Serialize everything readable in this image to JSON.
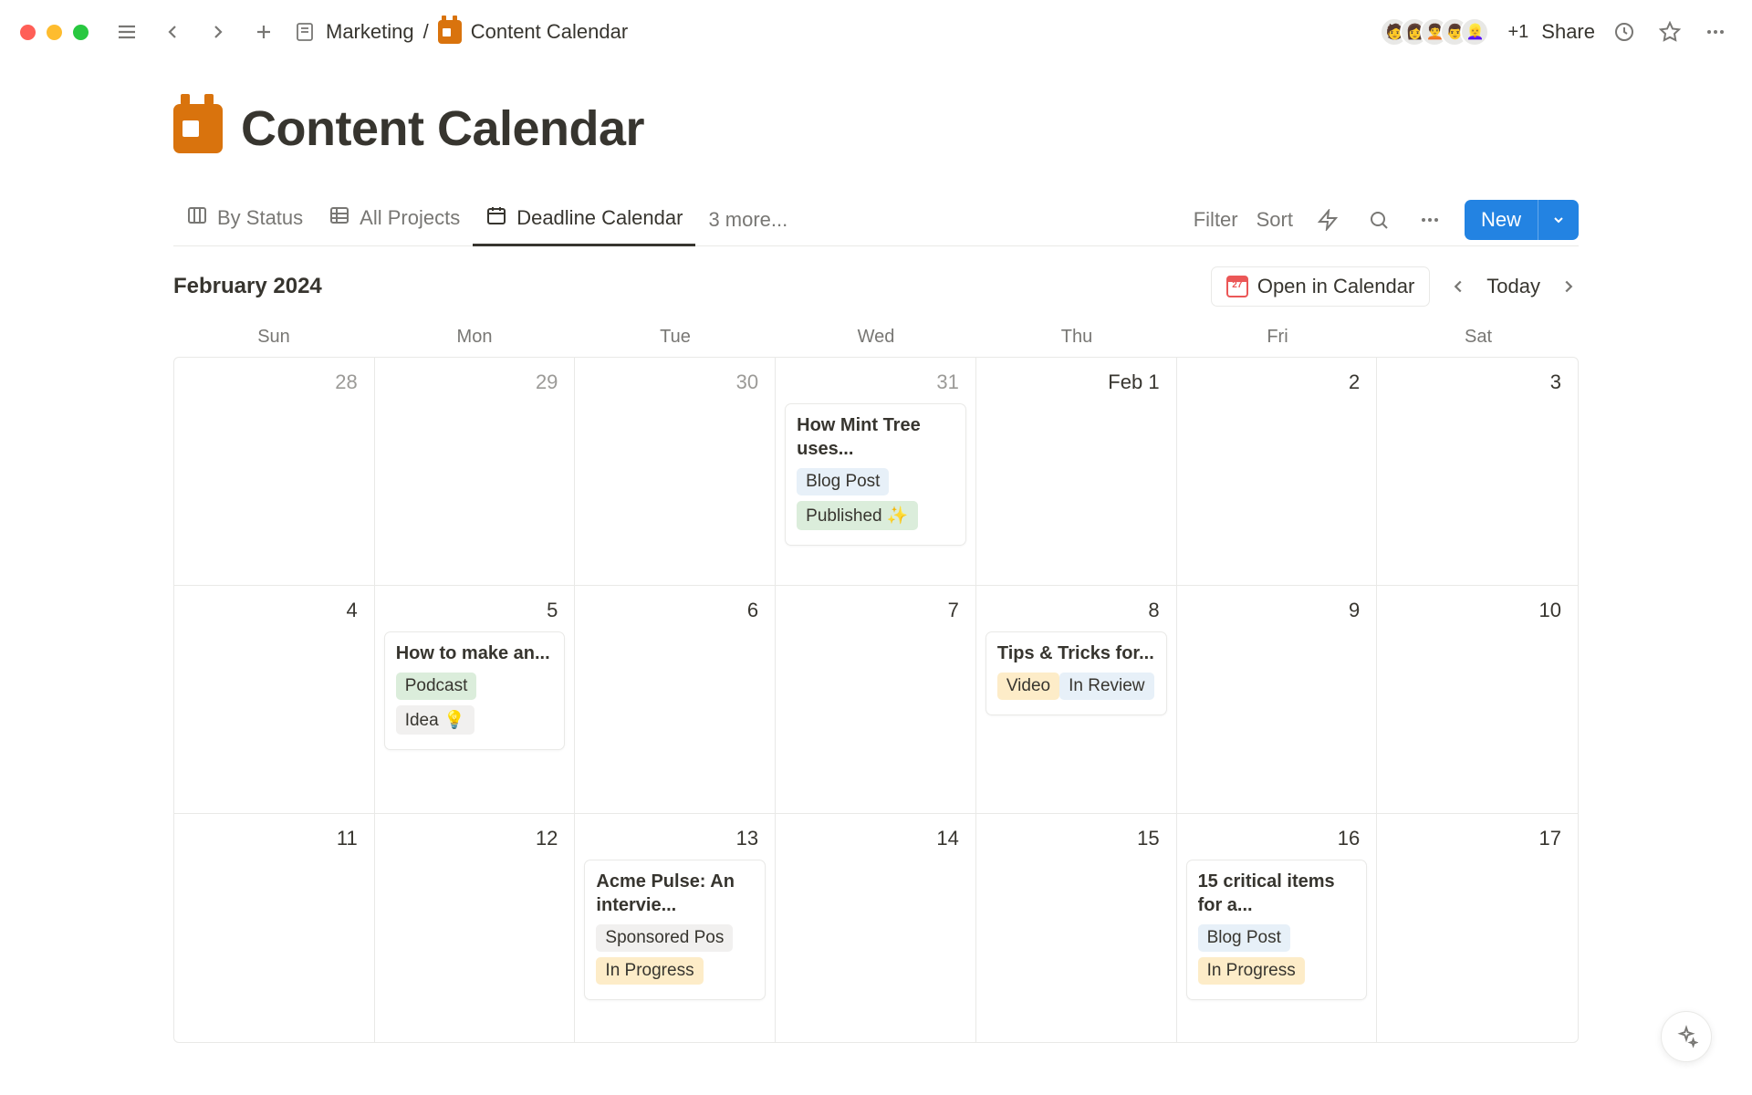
{
  "breadcrumb": {
    "parent": "Marketing",
    "current": "Content Calendar"
  },
  "avatar_more": "+1",
  "share_label": "Share",
  "page_title": "Content Calendar",
  "views": [
    {
      "label": "By Status",
      "icon": "board"
    },
    {
      "label": "All Projects",
      "icon": "table"
    },
    {
      "label": "Deadline Calendar",
      "icon": "calendar",
      "active": true
    }
  ],
  "views_more": "3 more...",
  "toolbar": {
    "filter": "Filter",
    "sort": "Sort",
    "new": "New"
  },
  "calendar": {
    "month_label": "February 2024",
    "open_in_calendar": "Open in Calendar",
    "today": "Today",
    "day_headers": [
      "Sun",
      "Mon",
      "Tue",
      "Wed",
      "Thu",
      "Fri",
      "Sat"
    ],
    "weeks": [
      [
        {
          "num": "28",
          "other": true
        },
        {
          "num": "29",
          "other": true
        },
        {
          "num": "30",
          "other": true
        },
        {
          "num": "31",
          "other": true,
          "cards": [
            {
              "title": "How Mint Tree uses...",
              "tags": [
                {
                  "text": "Blog Post",
                  "class": "tag-blogpost"
                },
                {
                  "text": "Published ✨",
                  "class": "tag-published"
                }
              ]
            }
          ]
        },
        {
          "num": "Feb 1",
          "first": true
        },
        {
          "num": "2"
        },
        {
          "num": "3"
        }
      ],
      [
        {
          "num": "4"
        },
        {
          "num": "5",
          "cards": [
            {
              "title": "How to make an...",
              "tags": [
                {
                  "text": "Podcast",
                  "class": "tag-podcast"
                },
                {
                  "text": "Idea 💡",
                  "class": "tag-idea"
                }
              ]
            }
          ]
        },
        {
          "num": "6"
        },
        {
          "num": "7"
        },
        {
          "num": "8",
          "cards": [
            {
              "title": "Tips & Tricks for...",
              "tags": [
                {
                  "text": "Video",
                  "class": "tag-video"
                },
                {
                  "text": "In Review",
                  "class": "tag-inreview"
                }
              ]
            }
          ]
        },
        {
          "num": "9"
        },
        {
          "num": "10"
        }
      ],
      [
        {
          "num": "11"
        },
        {
          "num": "12"
        },
        {
          "num": "13",
          "cards": [
            {
              "title": "Acme Pulse: An intervie...",
              "tags": [
                {
                  "text": "Sponsored Pos",
                  "class": "tag-sponsored"
                },
                {
                  "text": "In Progress",
                  "class": "tag-inprogress"
                }
              ]
            }
          ]
        },
        {
          "num": "14"
        },
        {
          "num": "15"
        },
        {
          "num": "16",
          "cards": [
            {
              "title": "15 critical items for a...",
              "tags": [
                {
                  "text": "Blog Post",
                  "class": "tag-blogpost"
                },
                {
                  "text": "In Progress",
                  "class": "tag-inprogress"
                }
              ]
            }
          ]
        },
        {
          "num": "17"
        }
      ]
    ]
  }
}
